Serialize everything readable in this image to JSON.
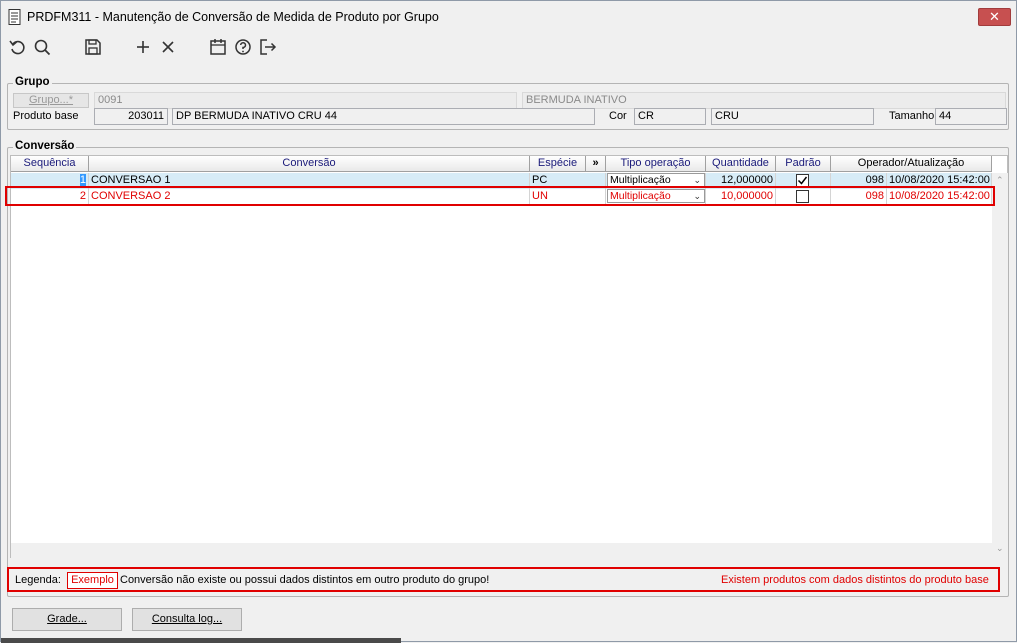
{
  "window": {
    "title": "PRDFM311 - Manutenção de Conversão de Medida de Produto por Grupo",
    "close_label": "✕"
  },
  "toolbar": {
    "icons": [
      "undo-icon",
      "search-icon",
      "save-icon",
      "add-icon",
      "delete-icon",
      "calendar-icon",
      "help-icon",
      "exit-icon"
    ]
  },
  "grupo": {
    "legend": "Grupo",
    "grupo_button": "Grupo...*",
    "grupo_code": "0091",
    "grupo_desc": "BERMUDA INATIVO",
    "produto_base_label": "Produto base",
    "produto_code": "203011",
    "produto_desc": "DP BERMUDA INATIVO CRU 44",
    "cor_label": "Cor",
    "cor_code": "CR",
    "cor_desc": "CRU",
    "tamanho_label": "Tamanho",
    "tamanho_value": "44"
  },
  "conversao": {
    "legend": "Conversão",
    "columns": {
      "sequencia": "Sequência",
      "conversao": "Conversão",
      "especie": "Espécie",
      "more": "»",
      "tipo_operacao": "Tipo operação",
      "quantidade": "Quantidade",
      "padrao": "Padrão",
      "operador": "Operador/Atualização"
    },
    "rows": [
      {
        "seq": "1",
        "conversao": "CONVERSAO 1",
        "especie": "PC",
        "tipo": "Multiplicação",
        "quantidade": "12,000000",
        "padrao": true,
        "operador": "098",
        "atualizacao": "10/08/2020 15:42:00"
      },
      {
        "seq": "2",
        "conversao": "CONVERSAO 2",
        "especie": "UN",
        "tipo": "Multiplicação",
        "quantidade": "10,000000",
        "padrao": false,
        "operador": "098",
        "atualizacao": "10/08/2020 15:42:00"
      }
    ]
  },
  "legenda": {
    "label": "Legenda:",
    "exemplo": "Exemplo",
    "text": "Conversão não existe ou possui dados distintos em outro produto do grupo!",
    "warning": "Existem produtos com dados distintos do produto base"
  },
  "buttons": {
    "grade": "Grade...",
    "consulta_log": "Consulta log..."
  },
  "colors": {
    "highlight_red": "#e00000",
    "selected_row": "#d7ecf7",
    "header_text": "#1a1a7a"
  }
}
